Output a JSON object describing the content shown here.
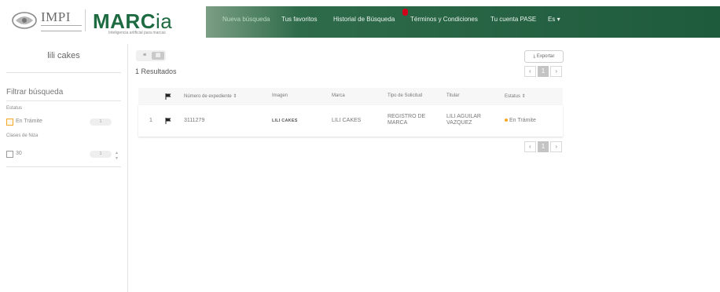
{
  "header": {
    "impi_logo": "IMPI",
    "app_logo": "MARC",
    "app_logo_suffix": "ia",
    "app_tagline": "Inteligencia artificial para marcas",
    "nav": [
      {
        "label": "Nueva búsqueda",
        "active": true
      },
      {
        "label": "Tus favoritos"
      },
      {
        "label": "Historial de Búsqueda",
        "badge": "1"
      },
      {
        "label": "Términos y Condiciones"
      },
      {
        "label": "Tu cuenta PASE"
      },
      {
        "label": "Es"
      }
    ]
  },
  "sidebar": {
    "query": "lili cakes",
    "filter_title": "Filtrar búsqueda",
    "estatus_label": "Estatus",
    "estatus_option": {
      "label": "En Trámite",
      "count": "1"
    },
    "clases_label": "Clases de Niza",
    "clase_option": {
      "label": "30",
      "count": "1"
    }
  },
  "main": {
    "results_label": "1 Resultados",
    "export_label": "Exportar",
    "pager": {
      "prev": "‹",
      "current": "1",
      "next": "›"
    },
    "table": {
      "headers": [
        "Número de expediente",
        "Imagen",
        "Marca",
        "Tipo de Solicitud",
        "Titular",
        "Estatus"
      ],
      "rows": [
        {
          "index": "1",
          "expediente": "3111279",
          "imagen": "LILI CAKES",
          "marca": "LILI CAKES",
          "tipo": "REGISTRO DE MARCA",
          "titular": "LILI AGUILAR VAZQUEZ",
          "estatus": "En Trámite"
        }
      ]
    }
  },
  "colors": {
    "header_green": "#1e5a3c",
    "brand_green": "#1e6b42",
    "status_orange": "#f5a623"
  },
  "icons": [
    "impi-seal-icon",
    "flag-icon",
    "sort-icon",
    "export-icon",
    "list-view-icon",
    "grid-view-icon",
    "checkbox-icon"
  ]
}
